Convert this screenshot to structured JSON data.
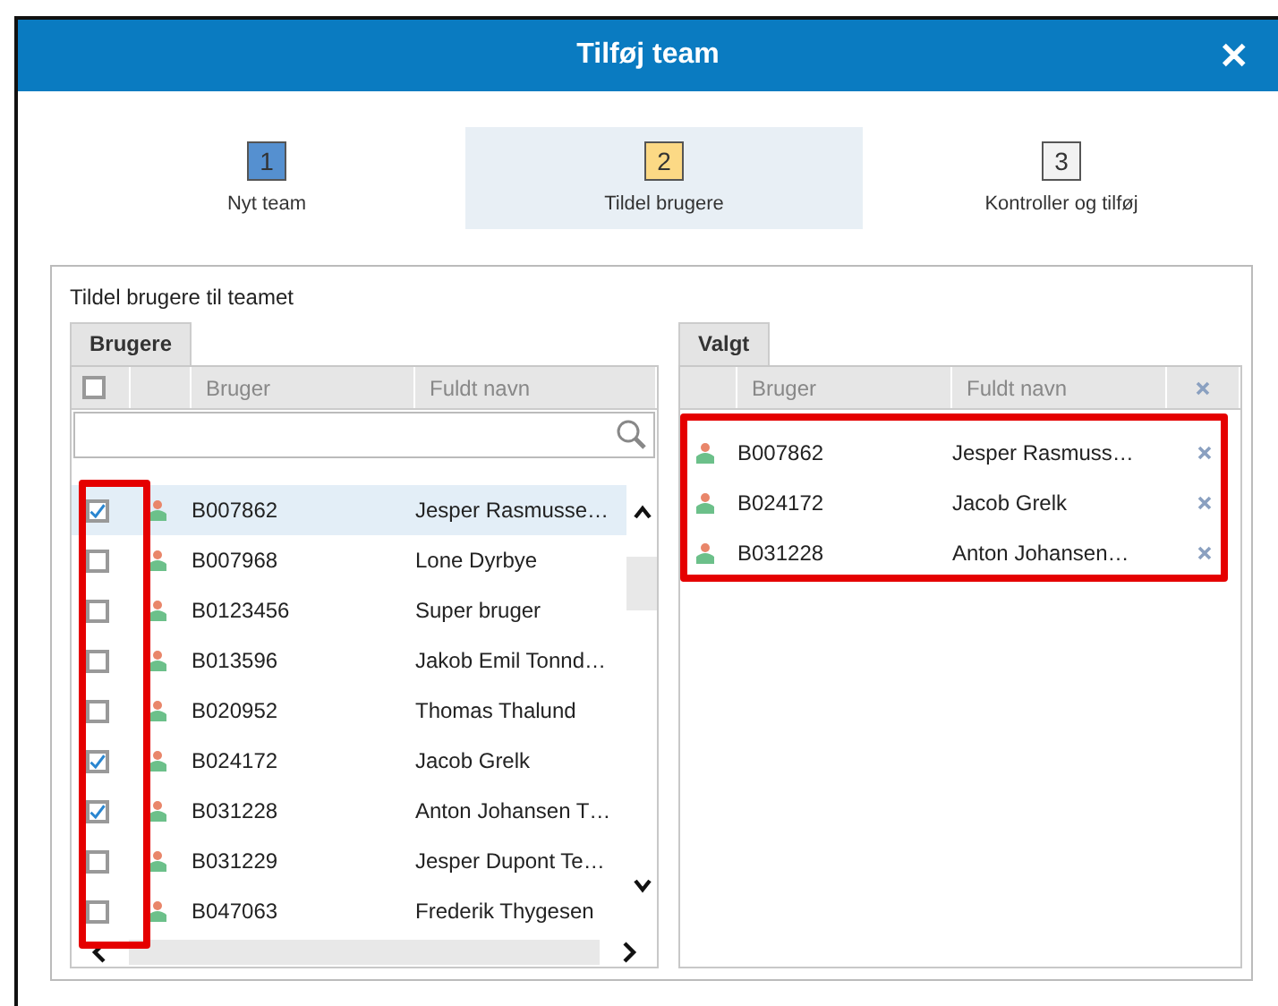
{
  "window": {
    "title": "Tilføj team",
    "close": "✕"
  },
  "steps": [
    {
      "number": "1",
      "label": "Nyt team",
      "selected": false,
      "color": "#5590d0"
    },
    {
      "number": "2",
      "label": "Tildel brugere",
      "selected": true,
      "color": "#fcd985"
    },
    {
      "number": "3",
      "label": "Kontroller og tilføj",
      "selected": false,
      "color": "#f2f2f2"
    }
  ],
  "section_title": "Tildel brugere til teamet",
  "users": {
    "tab": "Brugere",
    "select_all_checked": false,
    "columns": [
      "Bruger",
      "Fuldt navn"
    ],
    "rows": [
      {
        "id": "B007862",
        "name": "Jesper Rasmusse…",
        "checked": true,
        "selected": true
      },
      {
        "id": "B007968",
        "name": "Lone Dyrbye",
        "checked": false,
        "selected": false
      },
      {
        "id": "B0123456",
        "name": "Super bruger",
        "checked": false,
        "selected": false
      },
      {
        "id": "B013596",
        "name": "Jakob Emil Tonnd…",
        "checked": false,
        "selected": false
      },
      {
        "id": "B020952",
        "name": "Thomas Thalund",
        "checked": false,
        "selected": false
      },
      {
        "id": "B024172",
        "name": "Jacob Grelk",
        "checked": true,
        "selected": false
      },
      {
        "id": "B031228",
        "name": "Anton Johansen T…",
        "checked": true,
        "selected": false
      },
      {
        "id": "B031229",
        "name": "Jesper Dupont Te…",
        "checked": false,
        "selected": false
      },
      {
        "id": "B047063",
        "name": "Frederik Thygesen",
        "checked": false,
        "selected": false
      }
    ]
  },
  "chosen": {
    "tab": "Valgt",
    "columns": [
      "Bruger",
      "Fuldt navn"
    ],
    "rows": [
      {
        "id": "B007862",
        "name": "Jesper Rasmuss…"
      },
      {
        "id": "B024172",
        "name": "Jacob Grelk"
      },
      {
        "id": "B031228",
        "name": "Anton Johansen…"
      }
    ]
  }
}
